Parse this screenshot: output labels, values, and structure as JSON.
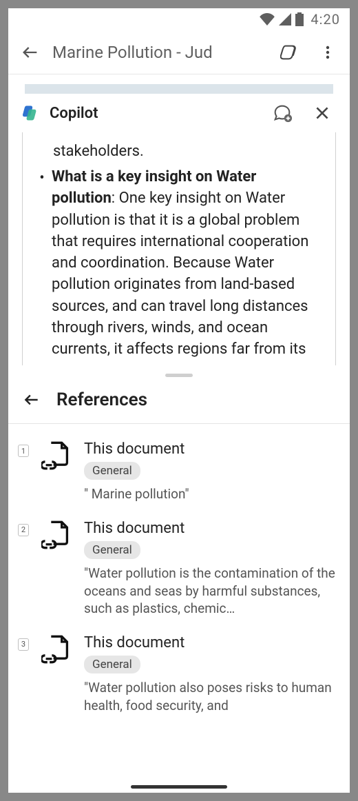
{
  "status": {
    "time": "4:20"
  },
  "appbar": {
    "title": "Marine Pollution - Jud"
  },
  "copilot": {
    "label": "Copilot",
    "fragment0": "stakeholders.",
    "bullet_title": "What is a key insight on Water pollution",
    "bullet_body": ": One key insight on Water pollution is that it is a global problem that requires international cooperation and coordination. Because Water pollution originates from land-based sources, and can travel long distances through rivers, winds, and ocean currents, it affects regions far from its"
  },
  "refs": {
    "title": "References",
    "items": [
      {
        "num": "1",
        "title": "This document",
        "type": "General",
        "snippet": "\" Marine pollution\""
      },
      {
        "num": "2",
        "title": "This document",
        "type": "General",
        "snippet": "\"Water pollution is the contamination of the oceans and seas by harmful substances, such as plastics, chemic…"
      },
      {
        "num": "3",
        "title": "This document",
        "type": "General",
        "snippet": "\"Water pollution also poses risks to human health, food security, and"
      }
    ]
  }
}
